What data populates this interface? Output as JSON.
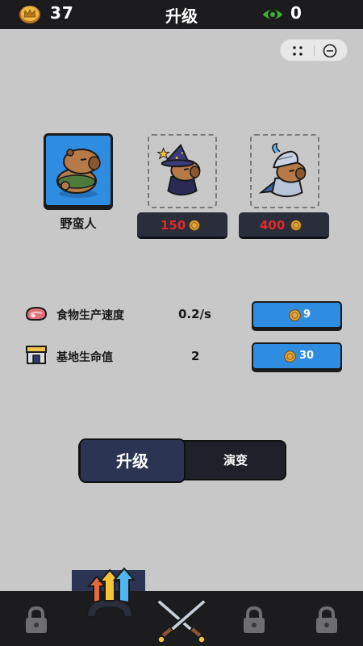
{
  "header": {
    "coins": "37",
    "title": "升级",
    "gems": "0",
    "coin_icon": "crown-coin-icon",
    "gem_icon": "green-eye-icon"
  },
  "characters": [
    {
      "name": "野蛮人",
      "state": "unlocked"
    },
    {
      "price": "150",
      "state": "locked"
    },
    {
      "price": "400",
      "state": "locked"
    }
  ],
  "stats": [
    {
      "icon": "meat-icon",
      "label": "食物生产速度",
      "value": "0.2/s",
      "cost": "9"
    },
    {
      "icon": "base-tower-icon",
      "label": "基地生命值",
      "value": "2",
      "cost": "30"
    }
  ],
  "tabs": {
    "upgrade": "升级",
    "evolve": "演变",
    "active": "upgrade"
  },
  "bottom_nav": [
    {
      "icon": "lock-icon",
      "active": false
    },
    {
      "icon": "upgrade-arrows-icon",
      "active": true
    },
    {
      "icon": "crossed-swords-icon",
      "active": false
    },
    {
      "icon": "lock-icon",
      "active": false
    },
    {
      "icon": "lock-icon",
      "active": false
    }
  ],
  "colors": {
    "background": "#c8c8c8",
    "bar": "#1c1c1e",
    "accent_blue": "#2f8de1",
    "price_red": "#e02a2a",
    "tab_active": "#2b3553",
    "coin_gold": "#e0a63a",
    "eye_green": "#3fae3a"
  }
}
